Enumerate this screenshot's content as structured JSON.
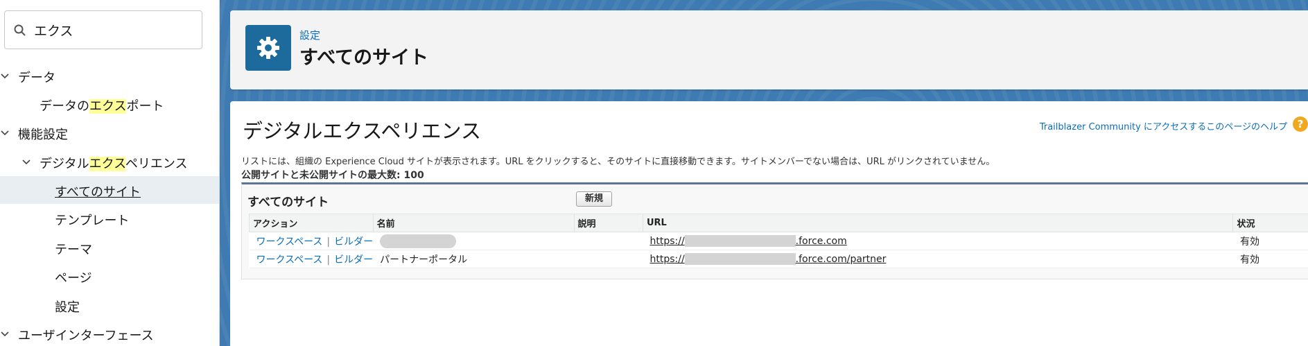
{
  "sidebar": {
    "search": {
      "value": "エクス"
    },
    "items": [
      {
        "label_pre": "",
        "label_hl": "",
        "label": "データ",
        "label_post": ""
      },
      {
        "label_pre": "データの",
        "label_hl": "エクス",
        "label_post": "ポート"
      },
      {
        "label": "機能設定"
      },
      {
        "label_pre": "デジタル",
        "label_hl": "エクス",
        "label_post": "ペリエンス"
      },
      {
        "label": "すべてのサイト"
      },
      {
        "label": "テンプレート"
      },
      {
        "label": "テーマ"
      },
      {
        "label": "ページ"
      },
      {
        "label": "設定"
      },
      {
        "label": "ユーザインターフェース"
      }
    ]
  },
  "header": {
    "icon": "gear-icon",
    "breadcrumb": "設定",
    "title": "すべてのサイト"
  },
  "content": {
    "title": "デジタルエクスペリエンス",
    "help_link": "Trailblazer Community にアクセスするこのページのヘルプ",
    "help_icon": "?",
    "description": "リストには、組織の Experience Cloud サイトが表示されます。URL をクリックすると、そのサイトに直接移動できます。サイトメンバーでない場合は、URL がリンクされていません。",
    "max_count": "公開サイトと未公開サイトの最大数: 100",
    "list": {
      "title": "すべてのサイト",
      "new_button": "新規",
      "columns": [
        "アクション",
        "名前",
        "説明",
        "URL",
        "状況"
      ],
      "rows": [
        {
          "workspace": "ワークスペース",
          "sep": "|",
          "builder": "ビルダー",
          "name": "",
          "description": "",
          "url_prefix": "https://",
          "url_suffix": ".force.com",
          "status": "有効"
        },
        {
          "workspace": "ワークスペース",
          "sep": "|",
          "builder": "ビルダー",
          "name": "パートナーポータル",
          "description": "",
          "url_prefix": "https://",
          "url_suffix": ".force.com/partner",
          "status": "有効"
        }
      ]
    }
  },
  "colors": {
    "brand_blue": "#1d6b9d",
    "link_blue": "#0b6dbb",
    "highlight": "#ffff99",
    "selected_bg": "#e8eef2",
    "help_orange": "#f0a81e"
  }
}
